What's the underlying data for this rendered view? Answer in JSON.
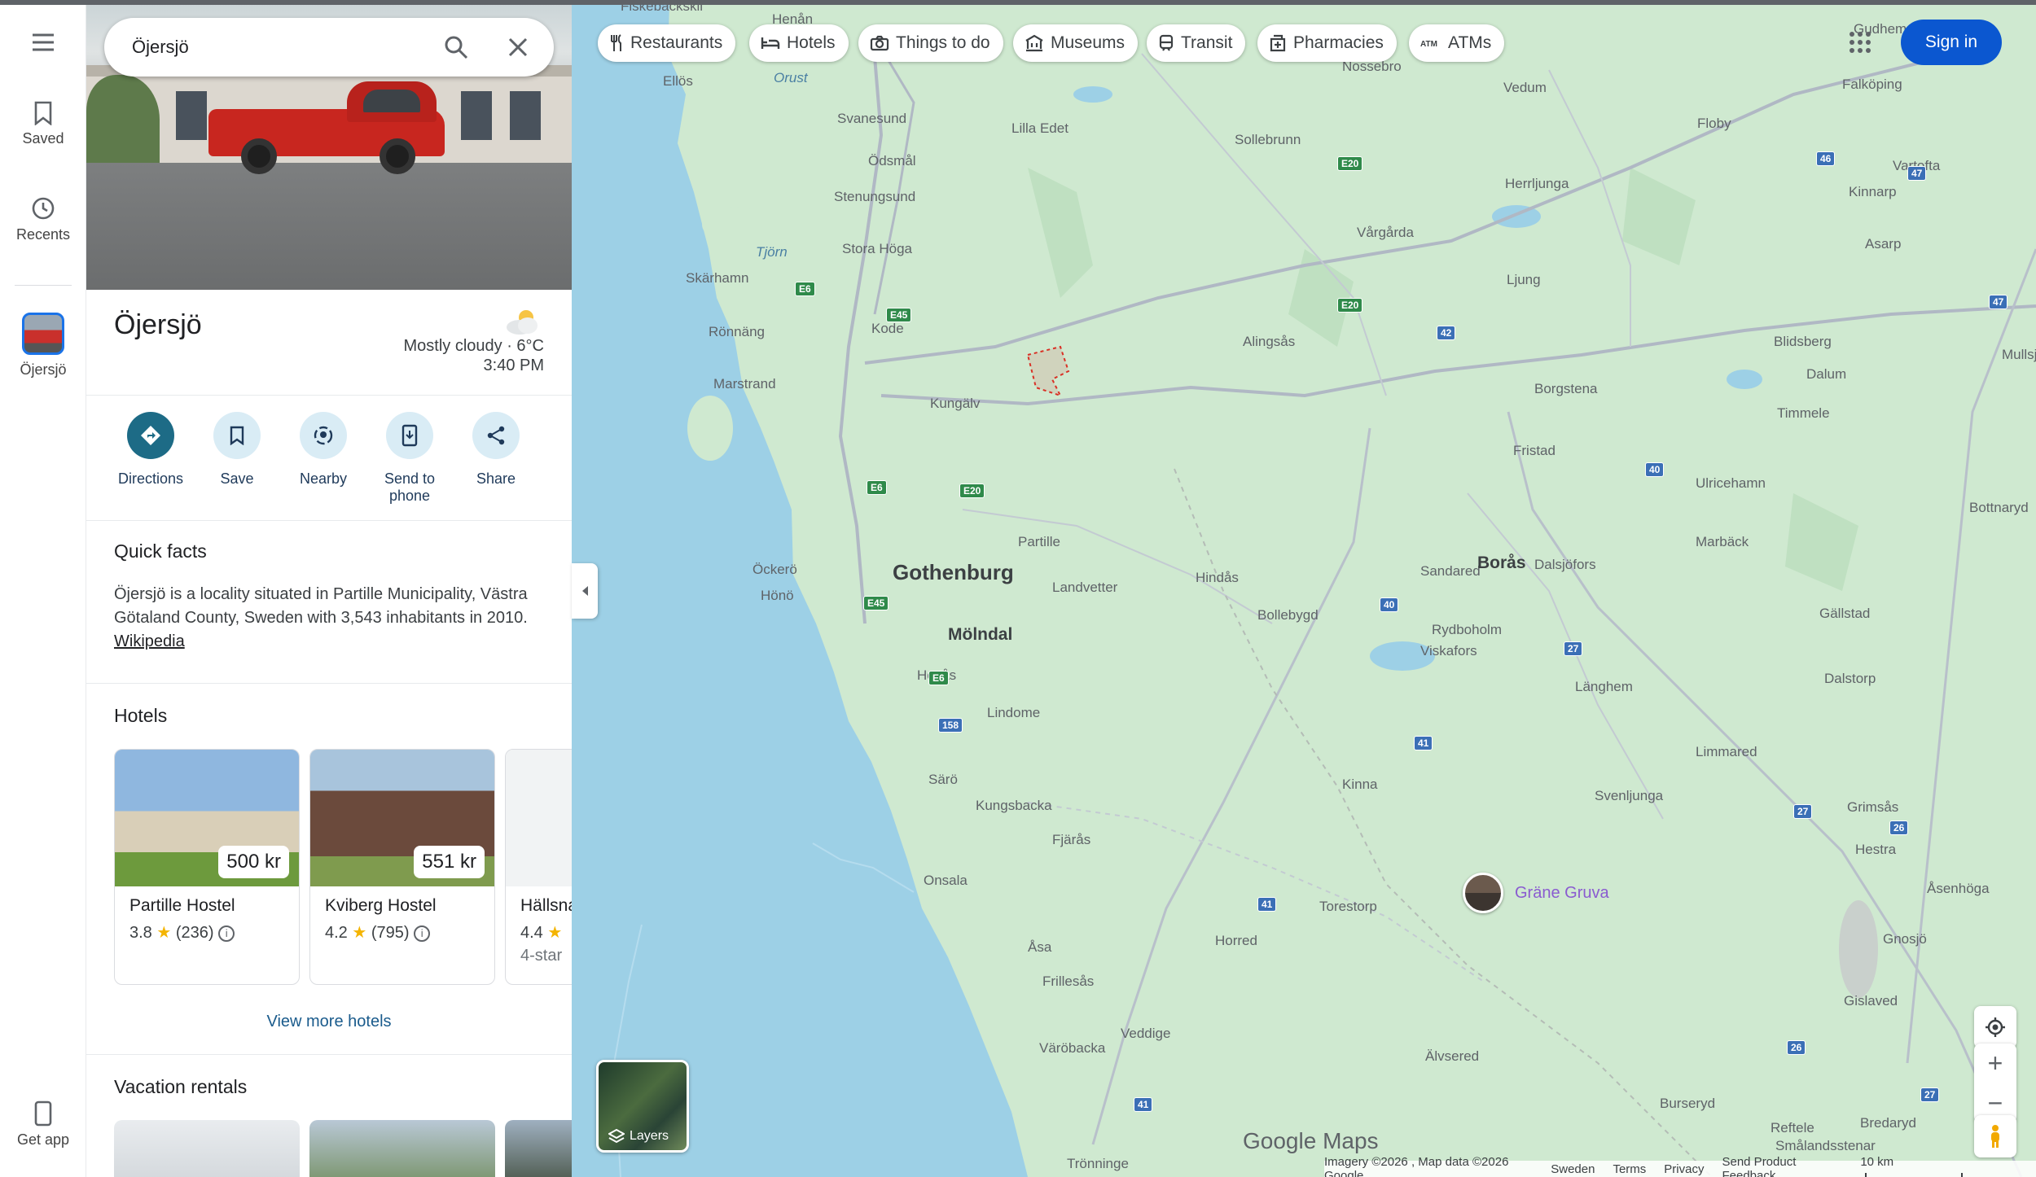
{
  "search": {
    "value": "Öjersjö"
  },
  "rail": {
    "saved": "Saved",
    "recents": "Recents",
    "place": "Öjersjö",
    "get_app": "Get app"
  },
  "place": {
    "title": "Öjersjö",
    "weather": "Mostly cloudy · 6°C",
    "time": "3:40 PM"
  },
  "actions": [
    "Directions",
    "Save",
    "Nearby",
    "Send to\nphone",
    "Share"
  ],
  "quick_facts": {
    "heading": "Quick facts",
    "text": "Öjersjö is a locality situated in Partille Municipality, Västra Götaland County, Sweden with 3,543 inhabitants in 2010.",
    "link": "Wikipedia"
  },
  "hotels": {
    "heading": "Hotels",
    "items": [
      {
        "price": "500 kr",
        "name": "Partille Hostel",
        "rating": "3.8",
        "reviews": "(236)"
      },
      {
        "price": "551 kr",
        "name": "Kviberg Hostel",
        "rating": "4.2",
        "reviews": "(795)"
      },
      {
        "price": "",
        "name": "Hällsna",
        "rating": "4.4",
        "class": "4-star"
      }
    ],
    "view_more": "View more hotels"
  },
  "rentals": {
    "heading": "Vacation rentals"
  },
  "chips": [
    "Restaurants",
    "Hotels",
    "Things to do",
    "Museums",
    "Transit",
    "Pharmacies",
    "ATMs"
  ],
  "sign_in": "Sign in",
  "layers": "Layers",
  "map_labels": {
    "cities": [
      "Gothenburg",
      "Mölndal"
    ],
    "poi": "Gräne Gruva",
    "places": [
      "Fiskebäckskil",
      "Henån",
      "Orust",
      "Ellös",
      "Svanesund",
      "Lilla Edet",
      "Ödsmål",
      "Stenungsund",
      "Tjörn",
      "Stora Höga",
      "Skärhamn",
      "Rönnäng",
      "Kode",
      "Marstrand",
      "Kungälv",
      "Öckerö",
      "Hönö",
      "Partille",
      "Landvetter",
      "Hindås",
      "Hovås",
      "Lindome",
      "Särö",
      "Kungsbacka",
      "Fjärås",
      "Onsala",
      "Åsa",
      "Frillesås",
      "Väröbacka",
      "Veddige",
      "Trönninge",
      "Horred",
      "Torestorp",
      "Kinna",
      "Älvsered",
      "Sandared",
      "Bollebygd",
      "Rydboholm",
      "Viskafors",
      "Borås",
      "Dalsjöfors",
      "Länghem",
      "Limmared",
      "Svenljunga",
      "Alingsås",
      "Vårgårda",
      "Herrljunga",
      "Ljung",
      "Borgstena",
      "Fristad",
      "Sollebrunn",
      "Nossebro",
      "Vedum",
      "Floby",
      "Falköping",
      "Vartofta",
      "Kinnarp",
      "Asarp",
      "Blidsberg",
      "Dalum",
      "Timmele",
      "Ulricehamn",
      "Marbäck",
      "Gällstad",
      "Dalstorp",
      "Grimsås",
      "Hestra",
      "Åsenhöga",
      "Gnosjö",
      "Gislaved",
      "Burseryd",
      "Reftele",
      "Bredaryd",
      "Smålandsstenar",
      "Gudhem",
      "Mullsjö",
      "Bottnaryd"
    ],
    "roads": [
      "E6",
      "E45",
      "E20",
      "40",
      "41",
      "27",
      "26",
      "42",
      "46",
      "47",
      "158"
    ]
  },
  "footer": [
    "Imagery ©2026 , Map data ©2026 Google",
    "Sweden",
    "Terms",
    "Privacy",
    "Send Product Feedback",
    "10 km"
  ],
  "brand": "Google Maps"
}
